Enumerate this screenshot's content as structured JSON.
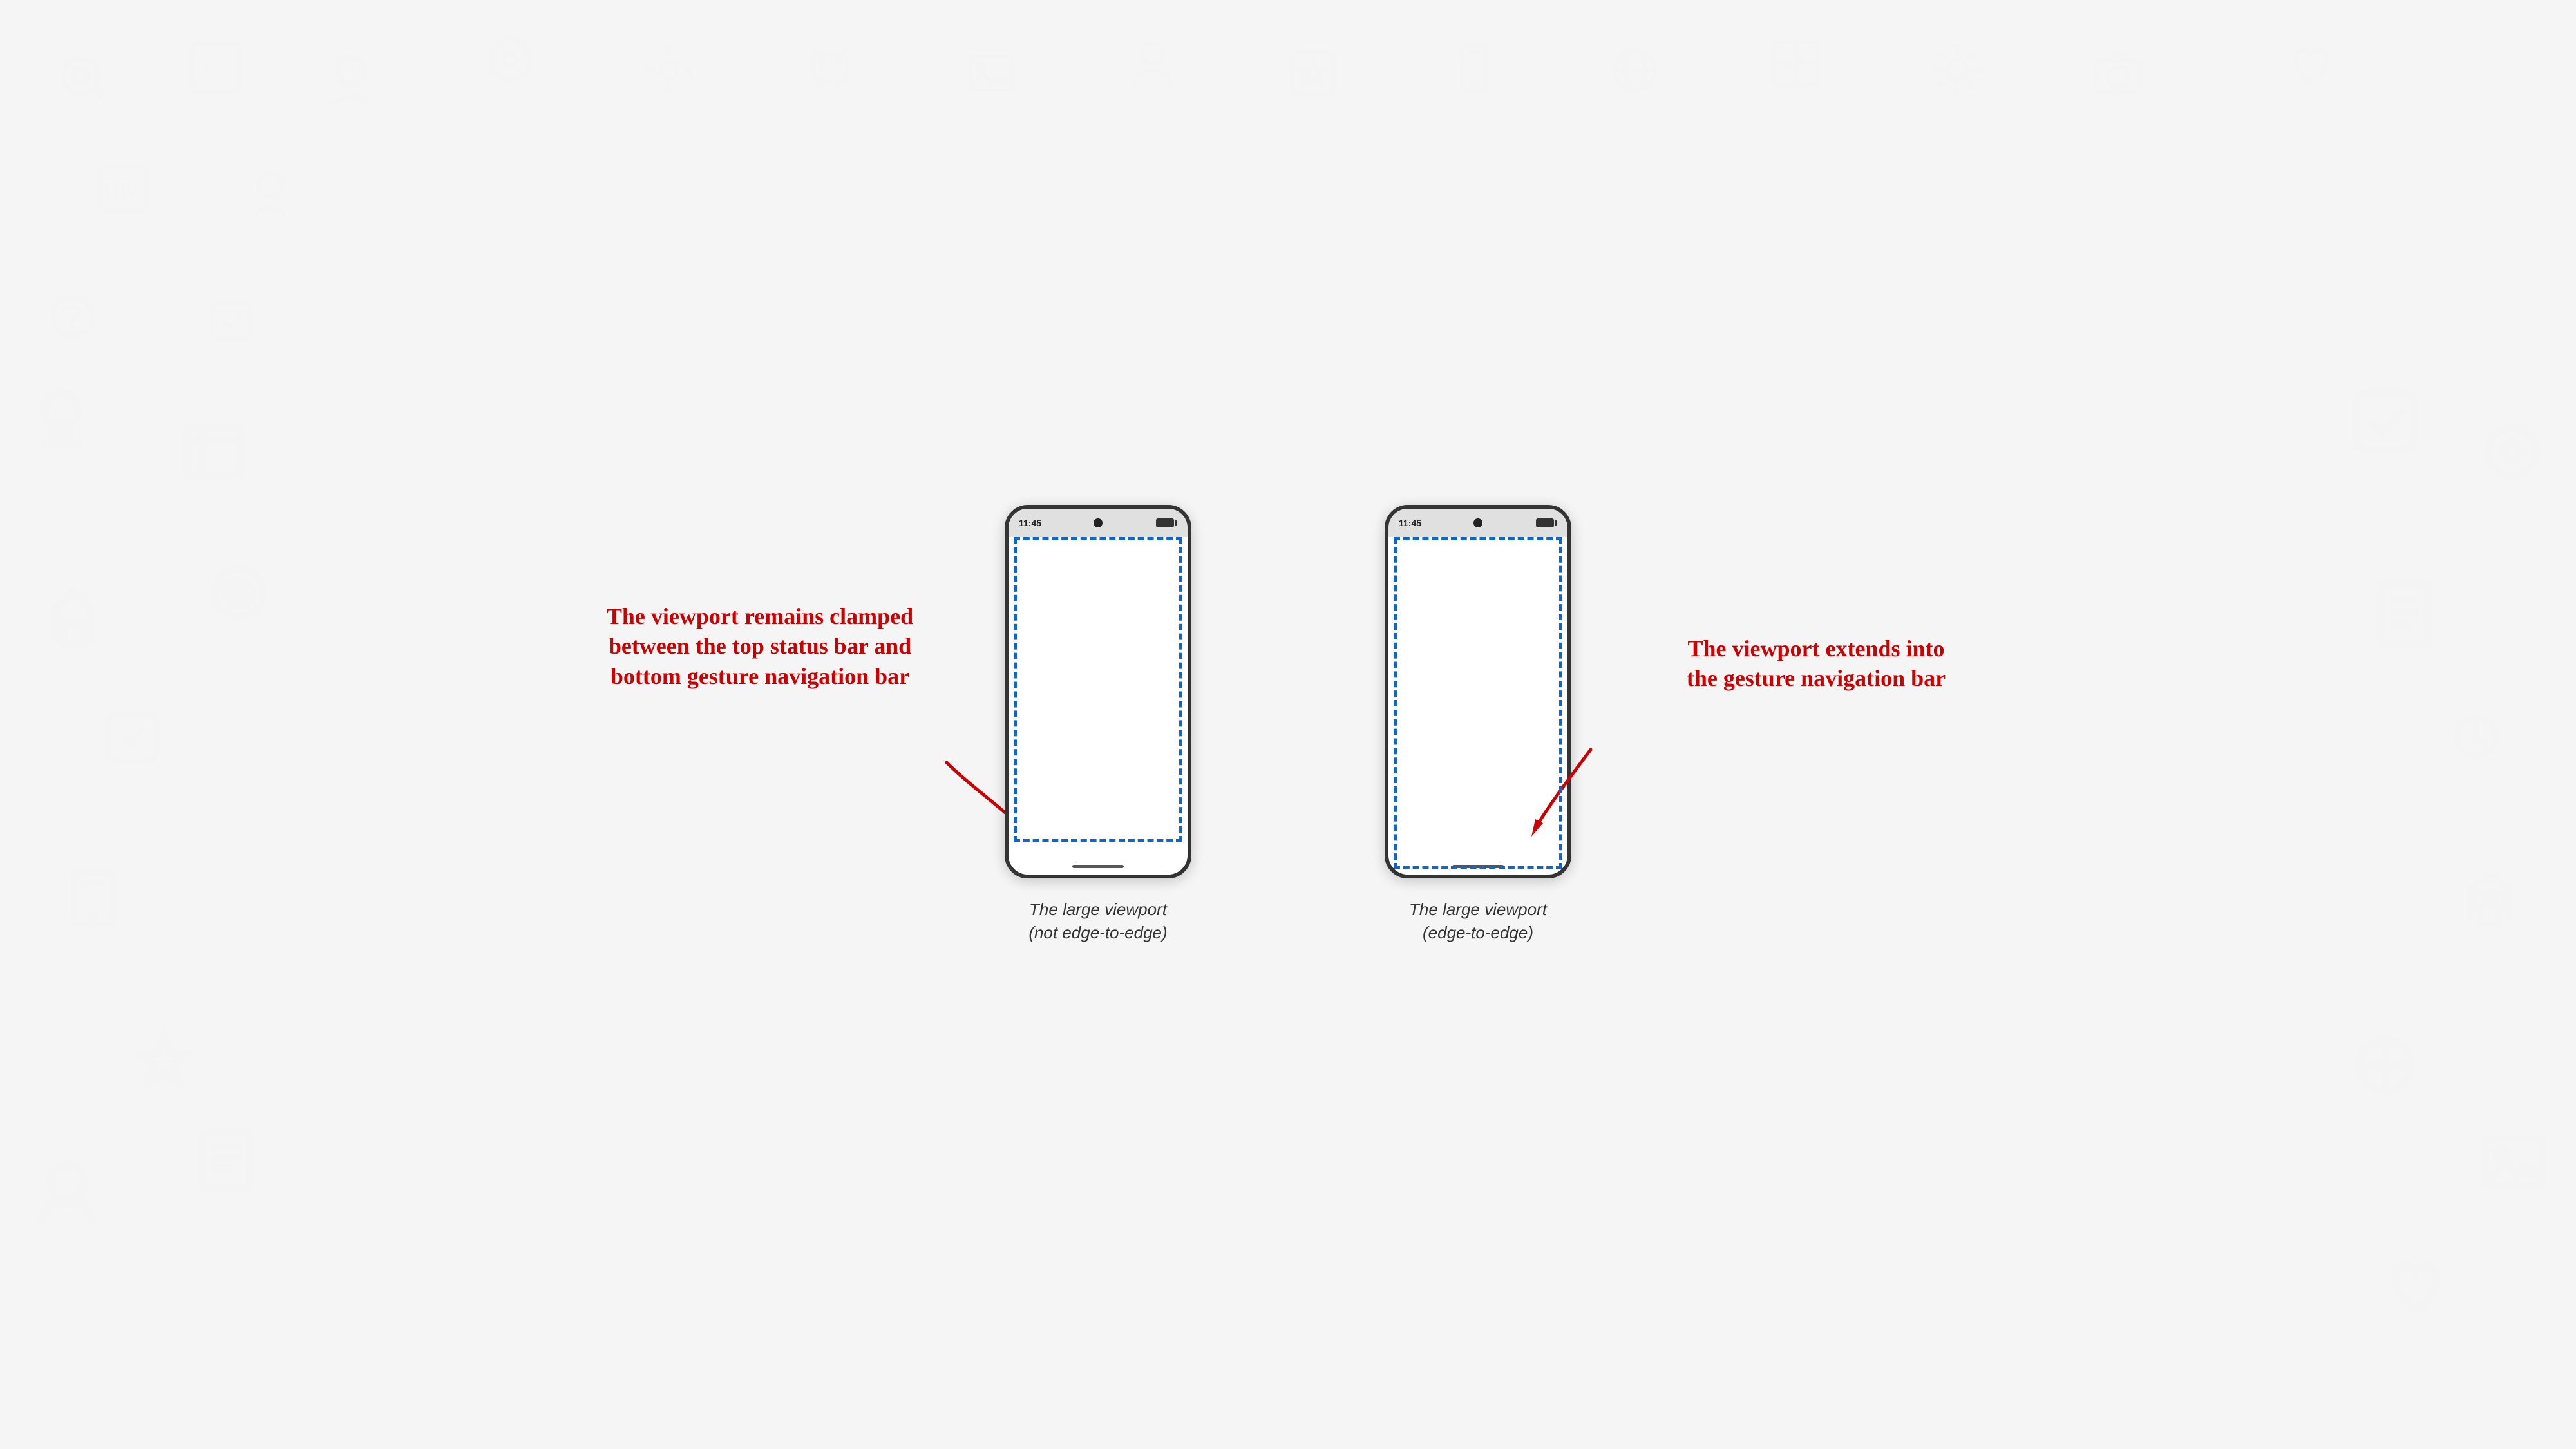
{
  "background": {
    "color": "#f5f5f5"
  },
  "phones": [
    {
      "id": "left",
      "status_time": "11:45",
      "caption_line1": "The large viewport",
      "caption_line2": "(not edge-to-edge)",
      "viewport_type": "clamped"
    },
    {
      "id": "right",
      "status_time": "11:45",
      "caption_line1": "The large viewport",
      "caption_line2": "(edge-to-edge)",
      "viewport_type": "full"
    }
  ],
  "annotations": [
    {
      "id": "left",
      "text": "The viewport remains clamped between the top status bar and bottom gesture navigation bar"
    },
    {
      "id": "right",
      "text": "The viewport extends into the gesture navigation bar"
    }
  ]
}
